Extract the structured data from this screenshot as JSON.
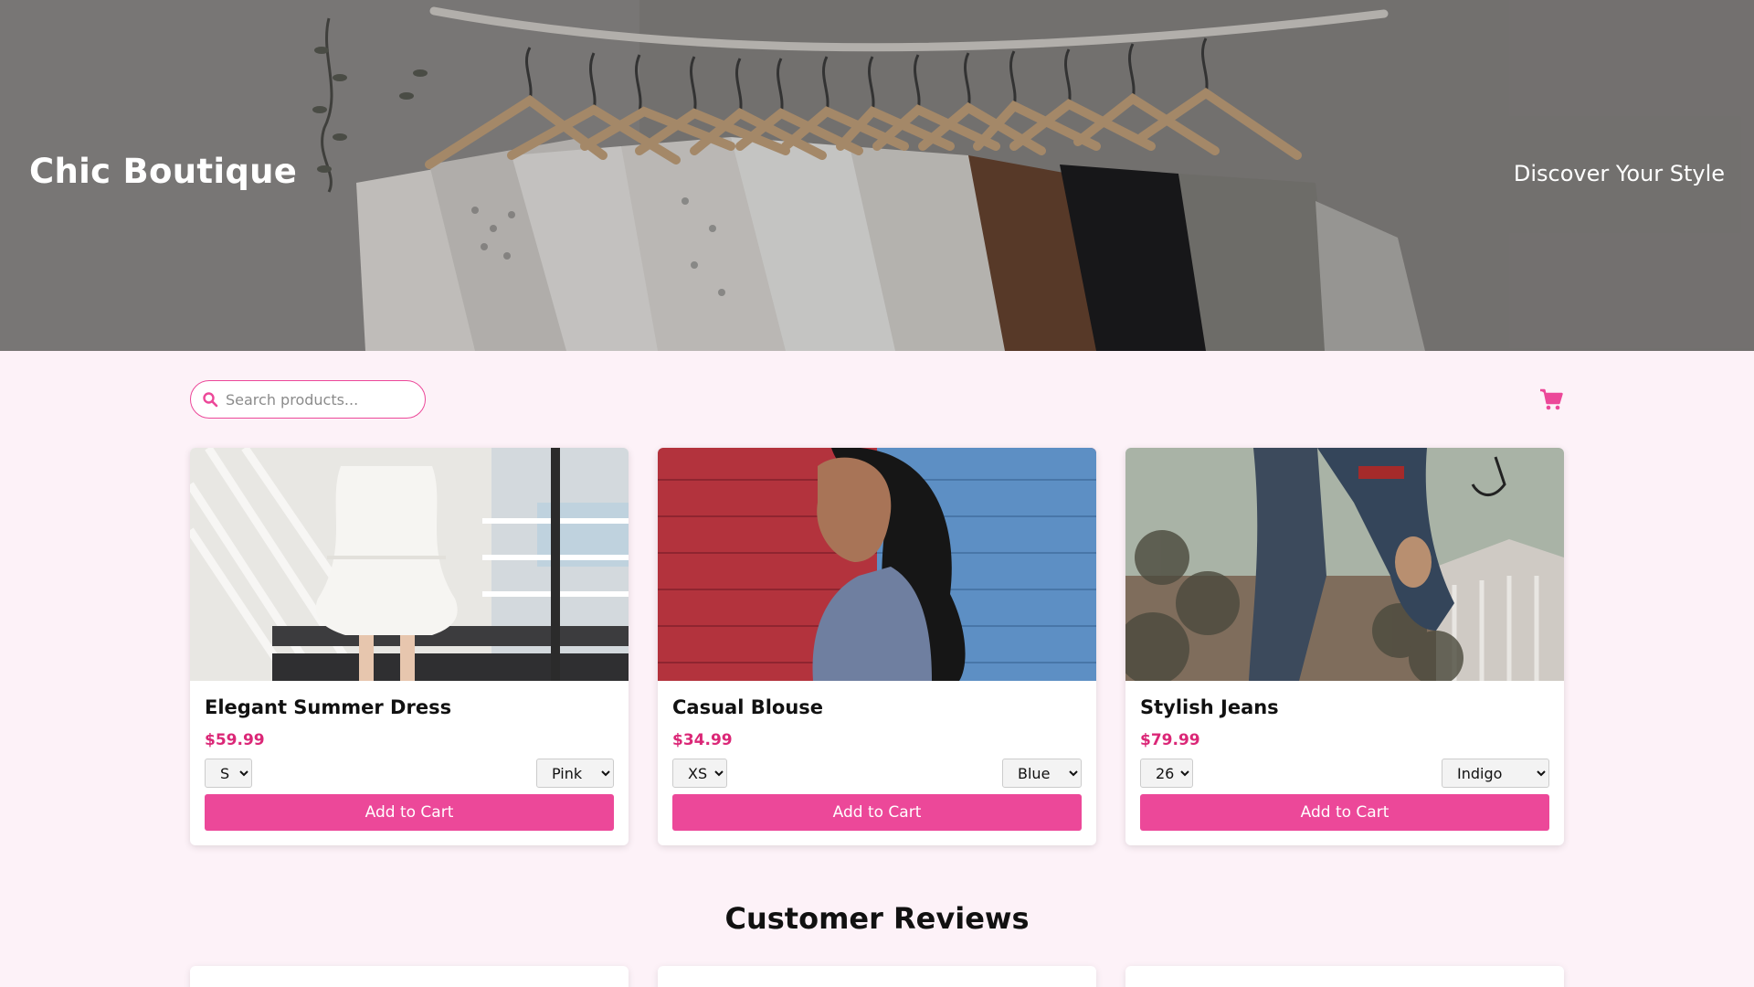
{
  "header": {
    "brand": "Chic Boutique",
    "tagline": "Discover Your Style"
  },
  "search": {
    "placeholder": "Search products...",
    "value": ""
  },
  "icons": {
    "search": "search-icon",
    "cart": "shopping-cart-icon"
  },
  "colors": {
    "accent": "#ec4899",
    "price": "#db2777",
    "page_background": "#fdf2f8"
  },
  "products": [
    {
      "title": "Elegant Summer Dress",
      "price": "$59.99",
      "size": "S",
      "color": "Pink",
      "button": "Add to Cart"
    },
    {
      "title": "Casual Blouse",
      "price": "$34.99",
      "size": "XS",
      "color": "Blue",
      "button": "Add to Cart"
    },
    {
      "title": "Stylish Jeans",
      "price": "$79.99",
      "size": "26",
      "color": "Indigo",
      "button": "Add to Cart"
    }
  ],
  "reviews": {
    "title": "Customer Reviews"
  }
}
